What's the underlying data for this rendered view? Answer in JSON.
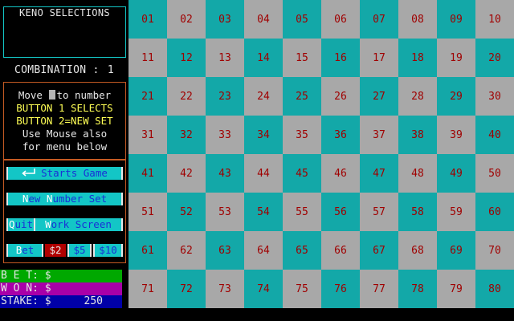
{
  "selections_title": "KENO SELECTIONS",
  "combination": {
    "label": "COMBINATION :",
    "value": "1"
  },
  "instructions": {
    "line1_pre": "Move",
    "line1_post": "to number",
    "line2": "BUTTON 1 SELECTS",
    "line3": "BUTTON 2=NEW SET",
    "line4": "Use Mouse also",
    "line5": "for menu below"
  },
  "menu": {
    "start": "Starts Game",
    "newset_hot1": "N",
    "newset_mid": "ew ",
    "newset_hot2": "N",
    "newset_rest": "umber Set",
    "quit_hot": "Q",
    "quit_rest": "uit",
    "work_hot": "W",
    "work_rest": "ork Screen",
    "bet_hot": "B",
    "bet_rest": "et",
    "bet2": "$2",
    "bet5": "$5",
    "bet10": "$10"
  },
  "stats": {
    "bet": {
      "label": "B E T: $",
      "value": ""
    },
    "won": {
      "label": "W O N: $",
      "value": ""
    },
    "stake": {
      "label": "STAKE: $",
      "value": "250"
    }
  },
  "colors": {
    "teal": "#13a8a8",
    "gray": "#a8a8a8",
    "number": "#a00000",
    "bet_bar": "#00a800",
    "won_bar": "#a800a8",
    "stake_bar": "#0000a8"
  },
  "numbers": [
    "01",
    "02",
    "03",
    "04",
    "05",
    "06",
    "07",
    "08",
    "09",
    "10",
    "11",
    "12",
    "13",
    "14",
    "15",
    "16",
    "17",
    "18",
    "19",
    "20",
    "21",
    "22",
    "23",
    "24",
    "25",
    "26",
    "27",
    "28",
    "29",
    "30",
    "31",
    "32",
    "33",
    "34",
    "35",
    "36",
    "37",
    "38",
    "39",
    "40",
    "41",
    "42",
    "43",
    "44",
    "45",
    "46",
    "47",
    "48",
    "49",
    "50",
    "51",
    "52",
    "53",
    "54",
    "55",
    "56",
    "57",
    "58",
    "59",
    "60",
    "61",
    "62",
    "63",
    "64",
    "65",
    "66",
    "67",
    "68",
    "69",
    "70",
    "71",
    "72",
    "73",
    "74",
    "75",
    "76",
    "77",
    "78",
    "79",
    "80"
  ]
}
